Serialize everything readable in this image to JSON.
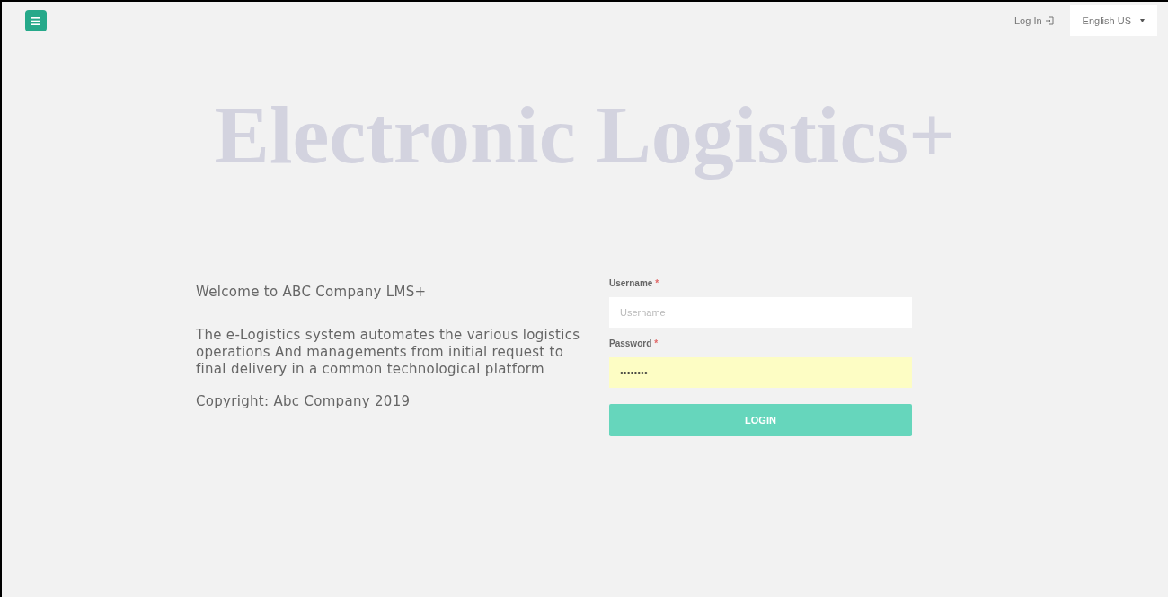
{
  "topbar": {
    "login_link": "Log In",
    "language": "English US"
  },
  "hero_title": "Electronic Logistics+",
  "intro": {
    "welcome": "Welcome to ABC Company LMS+",
    "description": "The e-Logistics system automates the various logistics operations And managements from initial request to final delivery in a common technological platform",
    "copyright": "Copyright: Abc Company 2019"
  },
  "form": {
    "fields": [
      {
        "label": "Username",
        "required_mark": "*",
        "placeholder": "Username",
        "autofilled": false
      },
      {
        "label": "Password",
        "required_mark": "*",
        "value": "••••••••",
        "autofilled": true
      }
    ],
    "submit": "LOGIN"
  }
}
